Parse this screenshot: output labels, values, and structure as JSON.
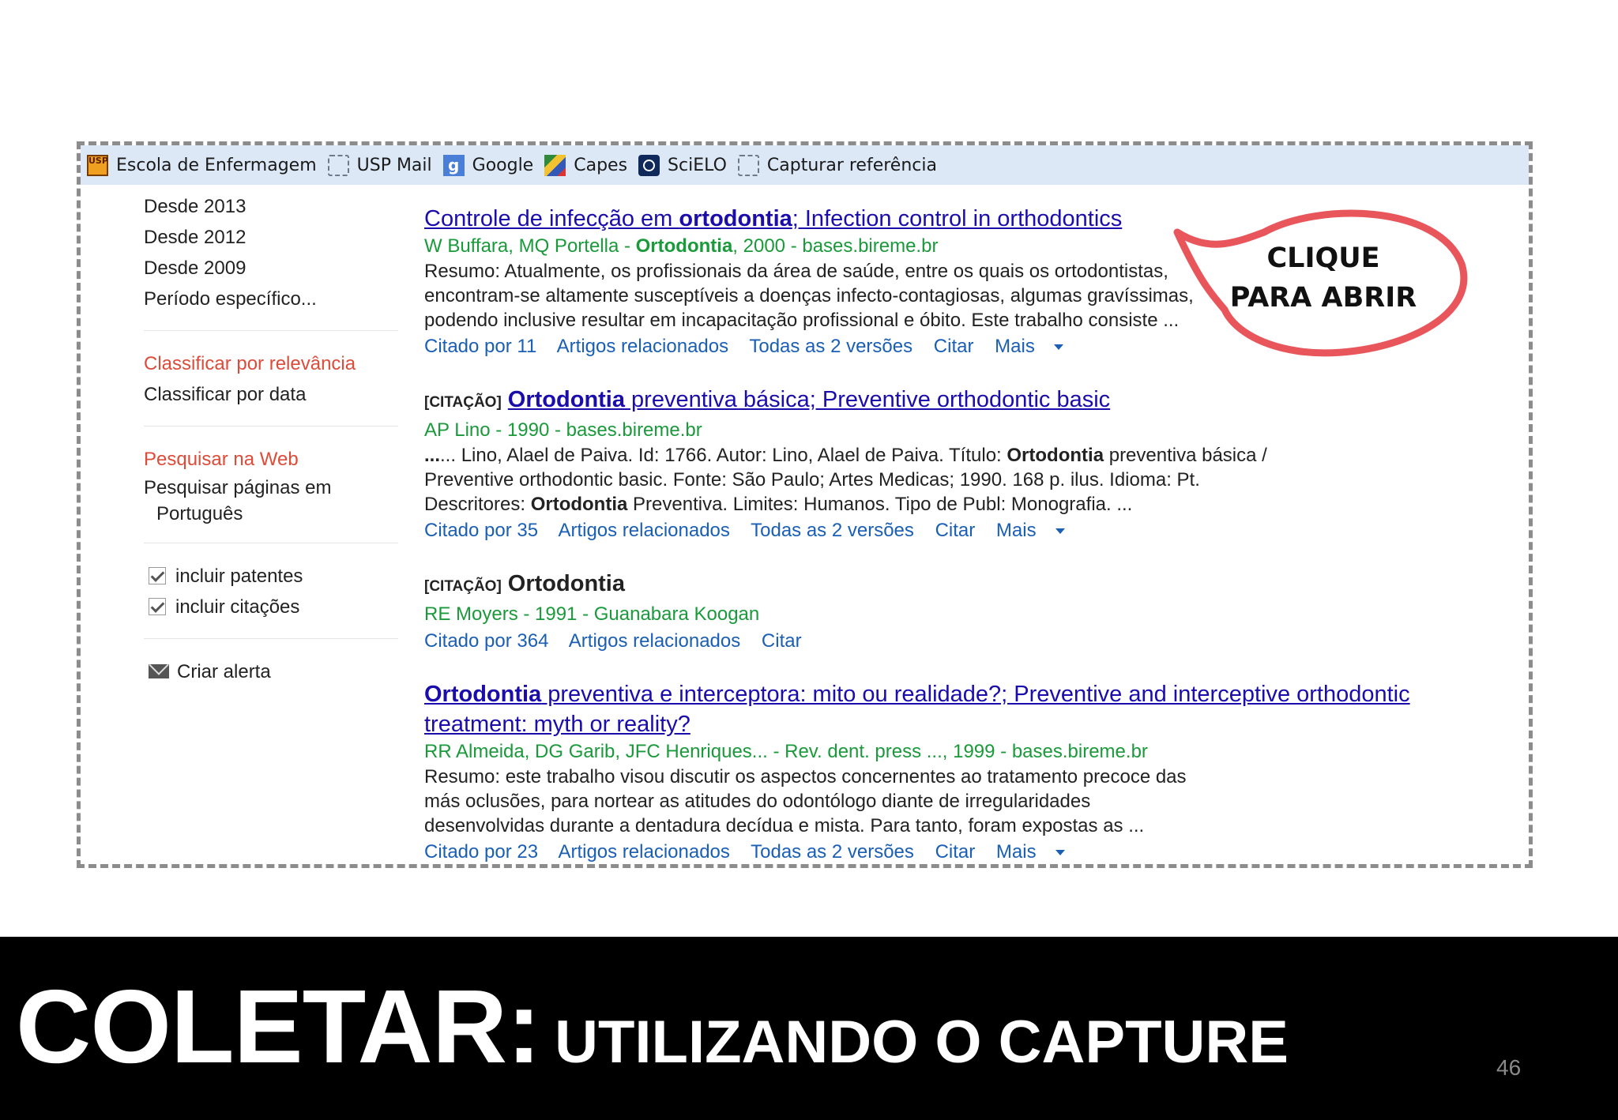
{
  "bookmarks": [
    {
      "label": "Escola de Enfermagem",
      "icon": "usp-icon",
      "badge": "USP"
    },
    {
      "label": "USP Mail",
      "icon": "bookmark-placeholder-icon"
    },
    {
      "label": "Google",
      "icon": "google-icon",
      "badge": "g"
    },
    {
      "label": "Capes",
      "icon": "capes-icon"
    },
    {
      "label": "SciELO",
      "icon": "scielo-icon"
    },
    {
      "label": "Capturar referência",
      "icon": "bookmark-placeholder-icon"
    }
  ],
  "sidebar": {
    "date_filters": [
      "Desde 2013",
      "Desde 2012",
      "Desde 2009",
      "Período específico..."
    ],
    "sort_relevance": "Classificar por relevância",
    "sort_date": "Classificar por data",
    "search_web": "Pesquisar na Web",
    "search_pages_line1": "Pesquisar páginas em",
    "search_pages_line2": "Português",
    "include_patents": "incluir patentes",
    "include_citations": "incluir citações",
    "create_alert": "Criar alerta"
  },
  "results": [
    {
      "title_pre": "Controle de infecção em ",
      "title_bold": "ortodontia",
      "title_post": "; Infection control in orthodontics",
      "meta_pre": "W Buffara, MQ Portella - ",
      "meta_bold": "Ortodontia",
      "meta_post": ", 2000 - bases.bireme.br",
      "snippet": [
        "Resumo: Atualmente, os profissionais da área de saúde, entre os quais os ortodontistas,",
        "encontram-se altamente susceptíveis a doenças infecto-contagiosas, algumas gravíssimas,",
        "podendo inclusive resultar em incapacitação profissional e óbito. Este trabalho consiste ..."
      ],
      "links": {
        "cited": "Citado por 11",
        "related": "Artigos relacionados",
        "versions": "Todas as 2 versões",
        "cite": "Citar",
        "more": "Mais"
      }
    },
    {
      "tag": "[CITAÇÃO]",
      "title_bold": "Ortodontia",
      "title_post": " preventiva básica; Preventive orthodontic basic",
      "meta": "AP Lino - 1990 - bases.bireme.br",
      "snippet_1_pre": "... Lino, Alael de Paiva. Id: 1766. Autor: Lino, Alael de Paiva. Título: ",
      "snippet_1_bold": "Ortodontia",
      "snippet_1_post": " preventiva básica /",
      "snippet_2": "Preventive orthodontic basic. Fonte: São Paulo; Artes Medicas; 1990. 168 p. ilus. Idioma: Pt.",
      "snippet_3_pre": "Descritores: ",
      "snippet_3_bold": "Ortodontia",
      "snippet_3_post": " Preventiva. Limites: Humanos. Tipo de Publ: Monografia. ...",
      "links": {
        "cited": "Citado por 35",
        "related": "Artigos relacionados",
        "versions": "Todas as 2 versões",
        "cite": "Citar",
        "more": "Mais"
      }
    },
    {
      "tag": "[CITAÇÃO]",
      "title": "Ortodontia",
      "meta": "RE Moyers - 1991 - Guanabara Koogan",
      "links": {
        "cited": "Citado por 364",
        "related": "Artigos relacionados",
        "cite": "Citar"
      }
    },
    {
      "title_bold": "Ortodontia",
      "title_post": " preventiva e interceptora: mito ou realidade?; Preventive and interceptive orthodontic",
      "title_line2": "treatment: myth or reality?",
      "meta": "RR Almeida, DG Garib, JFC Henriques... - Rev. dent. press ..., 1999 - bases.bireme.br",
      "snippet": [
        "Resumo: este trabalho visou discutir os aspectos concernentes ao tratamento precoce das",
        "más oclusões, para nortear as atitudes do odontólogo diante de irregularidades",
        "desenvolvidas durante a dentadura decídua e mista. Para tanto, foram expostas as ..."
      ],
      "links": {
        "cited": "Citado por 23",
        "related": "Artigos relacionados",
        "versions": "Todas as 2 versões",
        "cite": "Citar",
        "more": "Mais"
      }
    }
  ],
  "callout": {
    "line1": "CLIQUE",
    "line2": "PARA ABRIR",
    "color": "#e8555a"
  },
  "banner": {
    "title": "COLETAR:",
    "subtitle": "UTILIZANDO O CAPTURE",
    "page_number": "46"
  }
}
